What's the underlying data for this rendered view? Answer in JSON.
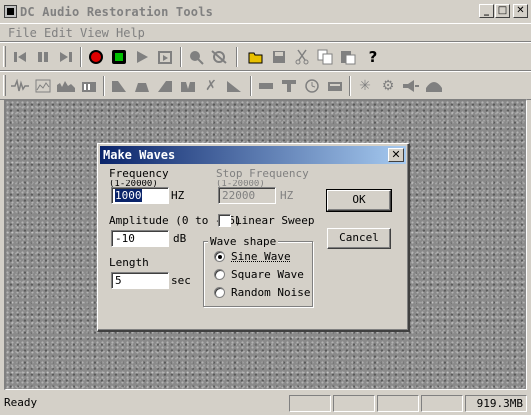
{
  "window": {
    "title": "DC Audio Restoration Tools",
    "minimize_icon": "minimize-icon",
    "maximize_icon": "maximize-icon",
    "close_icon": "close-icon"
  },
  "menu": [
    "File",
    "Edit",
    "View",
    "Help"
  ],
  "toolbar1": {
    "icons": [
      "skip-back-icon",
      "pause-icon",
      "skip-forward-icon",
      "record-icon",
      "stop-icon",
      "play-icon",
      "loop-play-icon",
      "zoom-icon",
      "zoom-fit-icon",
      "open-folder-icon",
      "save-icon",
      "cut-icon",
      "copy-icon",
      "paste-icon",
      "help-icon"
    ]
  },
  "toolbar2": {
    "icons": [
      "waveform-icon",
      "spectrum-icon",
      "levels-icon",
      "meter-icon",
      "filter-lowpass-icon",
      "filter-bandpass-icon",
      "filter-highpass-icon",
      "filter-notch-icon",
      "cross-fade-icon",
      "ramp-icon",
      "mono-icon",
      "split-icon",
      "clock-icon",
      "normalize-icon",
      "declick-icon",
      "brain-icon",
      "speaker-icon",
      "dome-icon"
    ]
  },
  "dialog": {
    "title": "Make Waves",
    "frequency": {
      "label": "Frequency",
      "range": "(1-20000)",
      "unit": "HZ",
      "value": "1000"
    },
    "stop_frequency": {
      "label": "Stop Frequency",
      "range": "(1-20000)",
      "unit": "HZ",
      "value": "22000"
    },
    "amplitude": {
      "label": "Amplitude (0 to -96)",
      "unit": "dB",
      "value": "-10"
    },
    "length": {
      "label": "Length",
      "unit": "sec",
      "value": "5"
    },
    "linear_sweep": {
      "label": "Linear Sweep",
      "checked": false
    },
    "wave_shape": {
      "title": "Wave shape",
      "options": [
        {
          "label": "Sine Wave",
          "checked": true
        },
        {
          "label": "Square Wave",
          "checked": false
        },
        {
          "label": "Random Noise",
          "checked": false
        }
      ]
    },
    "ok_label": "OK",
    "cancel_label": "Cancel"
  },
  "status": {
    "text": "Ready",
    "size": "919.3MB"
  }
}
